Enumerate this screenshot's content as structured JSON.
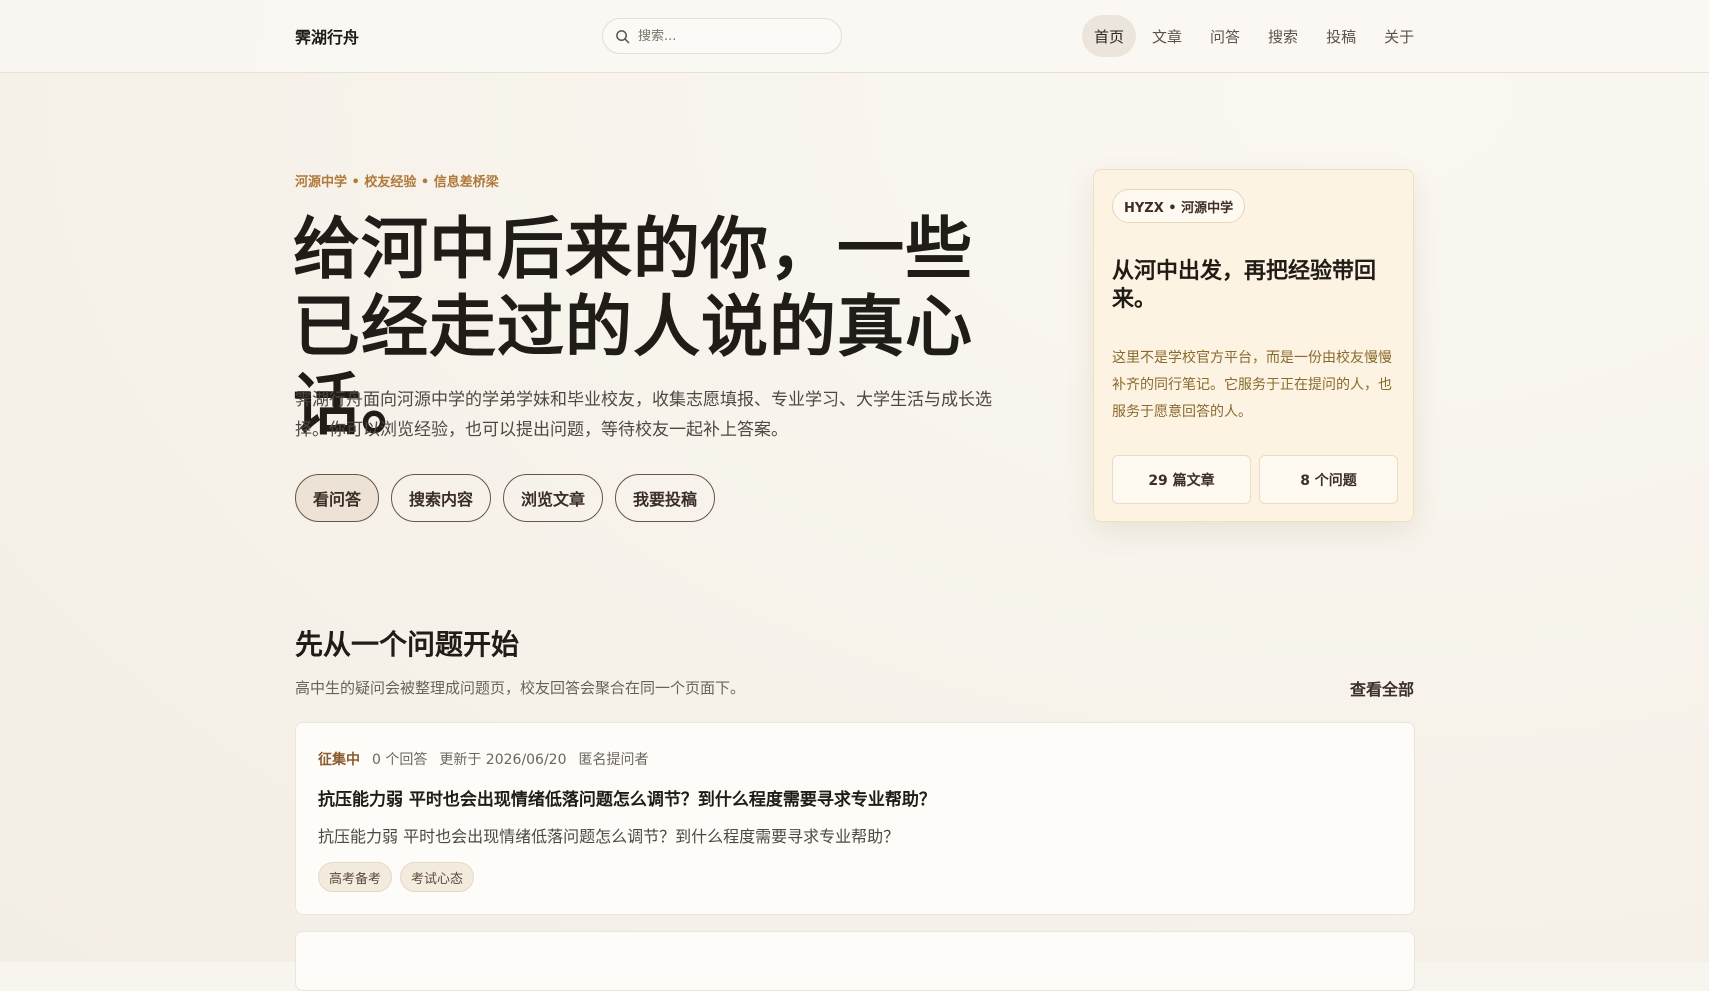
{
  "header": {
    "brand": "霁湖行舟",
    "search_placeholder": "搜索...",
    "nav": [
      "首页",
      "文章",
      "问答",
      "搜索",
      "投稿",
      "关于"
    ]
  },
  "hero": {
    "kicker": "河源中学 • 校友经验 • 信息差桥梁",
    "title": "给河中后来的你，一些已经走过的人说的真心话。",
    "description": "霁湖行舟面向河源中学的学弟学妹和毕业校友，收集志愿填报、专业学习、大学生活与成长选择。你可以浏览经验，也可以提出问题，等待校友一起补上答案。",
    "actions": [
      "看问答",
      "搜索内容",
      "浏览文章",
      "我要投稿"
    ]
  },
  "side_card": {
    "tag": "HYZX • 河源中学",
    "title": "从河中出发，再把经验带回来。",
    "description": "这里不是学校官方平台，而是一份由校友慢慢补齐的同行笔记。它服务于正在提问的人，也服务于愿意回答的人。",
    "stats": [
      "29 篇文章",
      "8 个问题"
    ]
  },
  "questions_section": {
    "title": "先从一个问题开始",
    "subtitle": "高中生的疑问会被整理成问题页，校友回答会聚合在同一个页面下。",
    "view_all": "查看全部",
    "items": [
      {
        "status": "征集中",
        "answers": "0 个回答",
        "updated": "更新于 2026/06/20",
        "author": "匿名提问者",
        "title": "抗压能力弱 平时也会出现情绪低落问题怎么调节？到什么程度需要寻求专业帮助？",
        "body": "抗压能力弱 平时也会出现情绪低落问题怎么调节？到什么程度需要寻求专业帮助？",
        "tags": [
          "高考备考",
          "考试心态"
        ]
      }
    ]
  }
}
